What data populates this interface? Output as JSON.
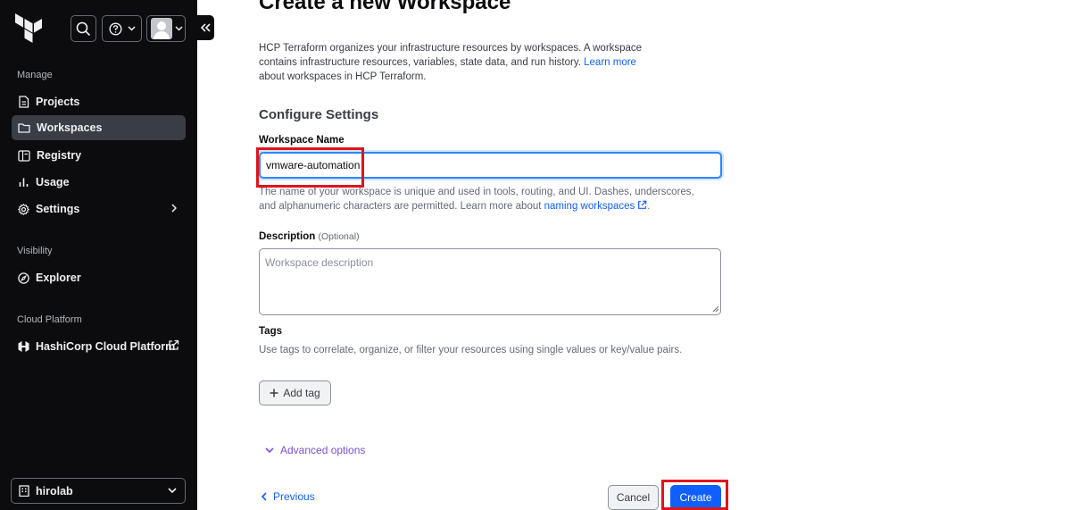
{
  "sidebar": {
    "sections": {
      "manage": "Manage",
      "visibility": "Visibility",
      "cloud": "Cloud Platform"
    },
    "items": [
      {
        "label": "Projects",
        "icon": "document-icon"
      },
      {
        "label": "Workspaces",
        "icon": "folder-icon",
        "active": true
      },
      {
        "label": "Registry",
        "icon": "registry-icon"
      },
      {
        "label": "Usage",
        "icon": "bar-chart-icon"
      },
      {
        "label": "Settings",
        "icon": "gear-icon"
      },
      {
        "label": "Explorer",
        "icon": "compass-icon"
      },
      {
        "label": "HashiCorp Cloud Platform",
        "icon": "hashicorp-icon"
      }
    ],
    "org": "hirolab"
  },
  "main": {
    "title": "Create a new Workspace",
    "intro_text": "HCP Terraform organizes your infrastructure resources by workspaces. A workspace contains infrastructure resources, variables, state data, and run history. ",
    "intro_link": "Learn more",
    "intro_tail": " about workspaces in HCP Terraform.",
    "section_title": "Configure Settings",
    "workspace_name": {
      "label": "Workspace Name",
      "value": "vmware-automation",
      "helper_text": "The name of your workspace is unique and used in tools, routing, and UI. Dashes, underscores, and alphanumeric characters are permitted. Learn more about ",
      "helper_link": "naming workspaces",
      "helper_tail": "."
    },
    "description": {
      "label": "Description",
      "optional": "(Optional)",
      "placeholder": "Workspace description"
    },
    "tags": {
      "label": "Tags",
      "help": "Use tags to correlate, organize, or filter your resources using single values or key/value pairs.",
      "add_label": "Add tag"
    },
    "advanced_label": "Advanced options",
    "previous_label": "Previous",
    "cancel_label": "Cancel",
    "create_label": "Create"
  },
  "colors": {
    "sidebar_bg": "#0c0c0e",
    "accent": "#1060ff",
    "advanced": "#7b4fd6",
    "highlight": "#e0131b"
  }
}
